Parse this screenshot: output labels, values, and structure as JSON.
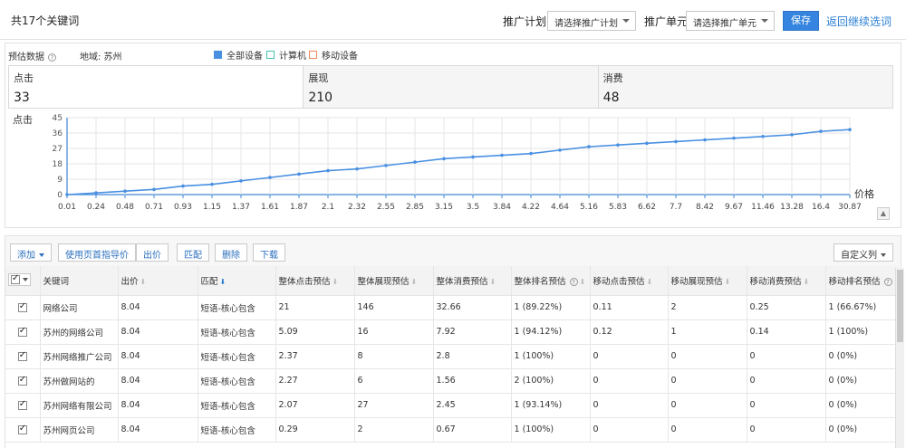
{
  "header": {
    "title": "共17个关键词",
    "plan_label": "推广计划",
    "plan_value": "请选择推广计划",
    "unit_label": "推广单元",
    "unit_value": "请选择推广单元",
    "save_label": "保存",
    "back_label": "返回继续选词"
  },
  "forecast": {
    "label": "预估数据",
    "region": "地域: 苏州",
    "legend": [
      {
        "label": "全部设备",
        "color": "#4a90e2",
        "filled": true
      },
      {
        "label": "计算机",
        "color": "#45c4b0",
        "filled": false
      },
      {
        "label": "移动设备",
        "color": "#f08a5d",
        "filled": false
      }
    ],
    "stats": [
      {
        "key": "点击",
        "value": "33"
      },
      {
        "key": "展现",
        "value": "210"
      },
      {
        "key": "消费",
        "value": "48"
      }
    ]
  },
  "chart_data": {
    "type": "line",
    "ylabel": "点击",
    "xlabel": "价格",
    "ylim": [
      0,
      45
    ],
    "yticks": [
      0,
      9,
      18,
      27,
      36,
      45
    ],
    "x": [
      "0.01",
      "0.24",
      "0.48",
      "0.71",
      "0.93",
      "1.15",
      "1.37",
      "1.61",
      "1.87",
      "2.1",
      "2.32",
      "2.55",
      "2.85",
      "3.15",
      "3.5",
      "3.84",
      "4.22",
      "4.64",
      "5.16",
      "5.83",
      "6.62",
      "7.7",
      "8.42",
      "9.67",
      "11.46",
      "13.28",
      "16.4",
      "30.87"
    ],
    "series": [
      {
        "color": "#4a90e2",
        "values": [
          0,
          1,
          2,
          3,
          5,
          6,
          8,
          10,
          12,
          14,
          15,
          17,
          19,
          21,
          22,
          23,
          24,
          26,
          28,
          29,
          30,
          31,
          32,
          33,
          34,
          35,
          37,
          38,
          39,
          40
        ]
      }
    ],
    "grid": true,
    "legend": "top"
  },
  "toolbar": {
    "add_label": "添加",
    "use_first_label": "使用页首指导价",
    "bid_label": "出价",
    "match_label": "匹配",
    "delete_label": "删除",
    "download_label": "下载",
    "custom_cols_label": "自定义列"
  },
  "table": {
    "columns": [
      "关键词",
      "出价",
      "匹配",
      "整体点击预估",
      "整体展现预估",
      "整体消费预估",
      "整体排名预估",
      "移动点击预估",
      "移动展现预估",
      "移动消费预估",
      "移动排名预估"
    ],
    "rows": [
      [
        "网络公司",
        "8.04",
        "短语-核心包含",
        "21",
        "146",
        "32.66",
        "1 (89.22%)",
        "0.11",
        "2",
        "0.25",
        "1 (66.67%)"
      ],
      [
        "苏州的网络公司",
        "8.04",
        "短语-核心包含",
        "5.09",
        "16",
        "7.92",
        "1 (94.12%)",
        "0.12",
        "1",
        "0.14",
        "1 (100%)"
      ],
      [
        "苏州网络推广公司",
        "8.04",
        "短语-核心包含",
        "2.37",
        "8",
        "2.8",
        "1 (100%)",
        "0",
        "0",
        "0",
        "0 (0%)"
      ],
      [
        "苏州做网站的",
        "8.04",
        "短语-核心包含",
        "2.27",
        "6",
        "1.56",
        "2 (100%)",
        "0",
        "0",
        "0",
        "0 (0%)"
      ],
      [
        "苏州网络有限公司",
        "8.04",
        "短语-核心包含",
        "2.07",
        "27",
        "2.45",
        "1 (93.14%)",
        "0",
        "0",
        "0",
        "0 (0%)"
      ],
      [
        "苏州网页公司",
        "8.04",
        "短语-核心包含",
        "0.29",
        "2",
        "0.67",
        "1 (100%)",
        "0",
        "0",
        "0",
        "0 (0%)"
      ]
    ]
  }
}
